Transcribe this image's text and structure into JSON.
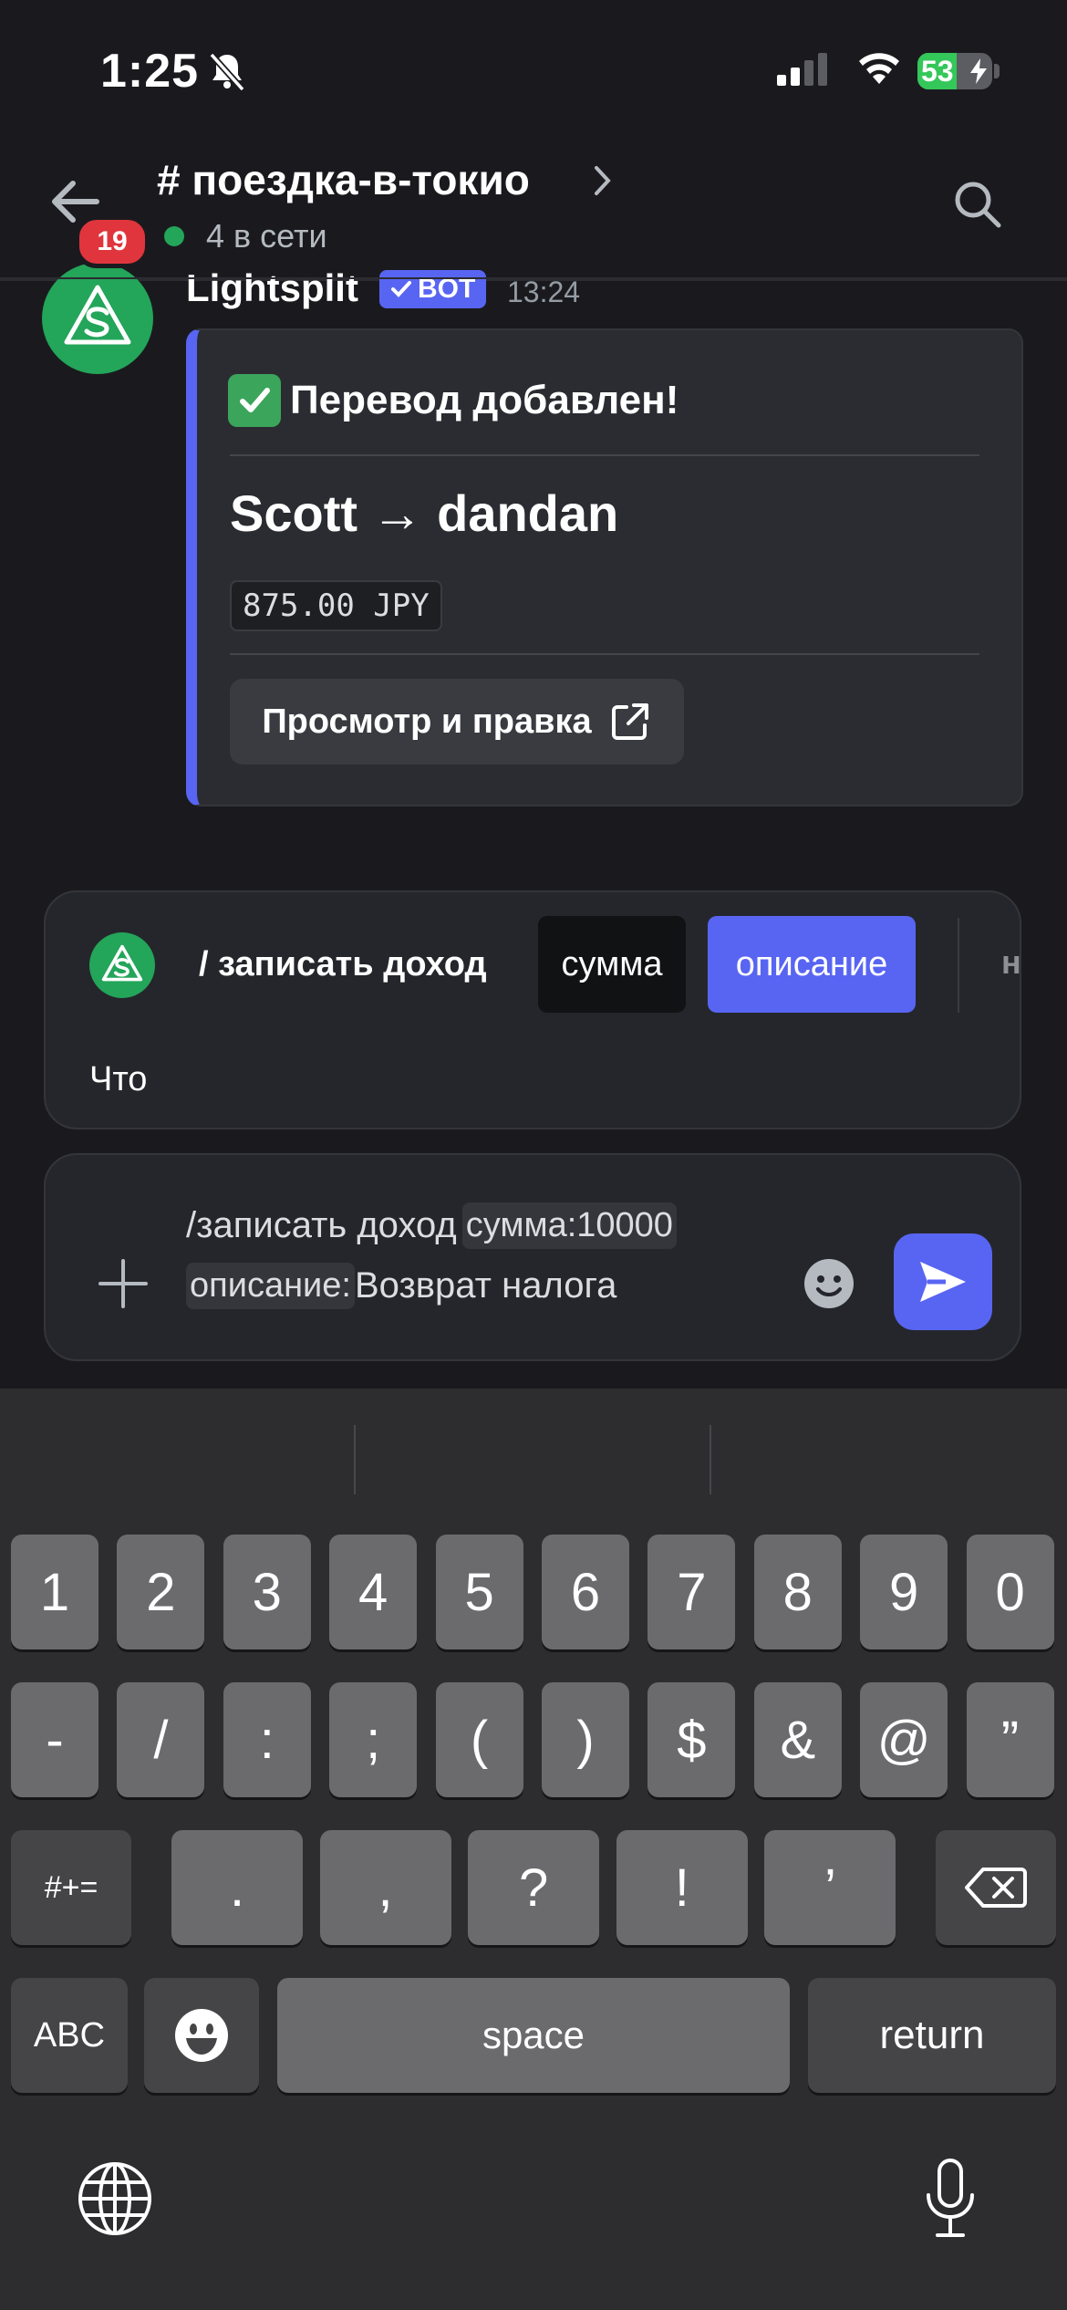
{
  "status_bar": {
    "time": "1:25",
    "battery_level": "53",
    "battery_fraction": 0.53
  },
  "header": {
    "channel": "# поездка-в-токио",
    "online": "4 в сети",
    "unread_badge": "19"
  },
  "message": {
    "author": "Lightsplit",
    "bot_tag": "BOT",
    "time": "13:24",
    "embed": {
      "title": "Перевод добавлен!",
      "transfer": "Scott → dandan",
      "amount": "875.00 JPY",
      "button": "Просмотр и правка"
    }
  },
  "autocomplete": {
    "command": "/ записать доход",
    "options": [
      "сумма",
      "описание"
    ],
    "next_option": "н",
    "prompt": "Что"
  },
  "input": {
    "command": "/записать доход",
    "param1_name": "сумма:",
    "param1_value": "10000",
    "param2_name": "описание:",
    "param2_value": "Возврат налога"
  },
  "keyboard": {
    "row1": [
      "1",
      "2",
      "3",
      "4",
      "5",
      "6",
      "7",
      "8",
      "9",
      "0"
    ],
    "row2": [
      "-",
      "/",
      ":",
      ";",
      "(",
      ")",
      "$",
      "&",
      "@",
      "”"
    ],
    "row3": [
      ".",
      ",",
      "?",
      "!",
      "’"
    ],
    "shift_label": "#+=",
    "abc_label": "ABC",
    "space_label": "space",
    "return_label": "return"
  },
  "colors": {
    "accent": "#5865f2",
    "online": "#23a55a",
    "badge": "#e0353d"
  }
}
